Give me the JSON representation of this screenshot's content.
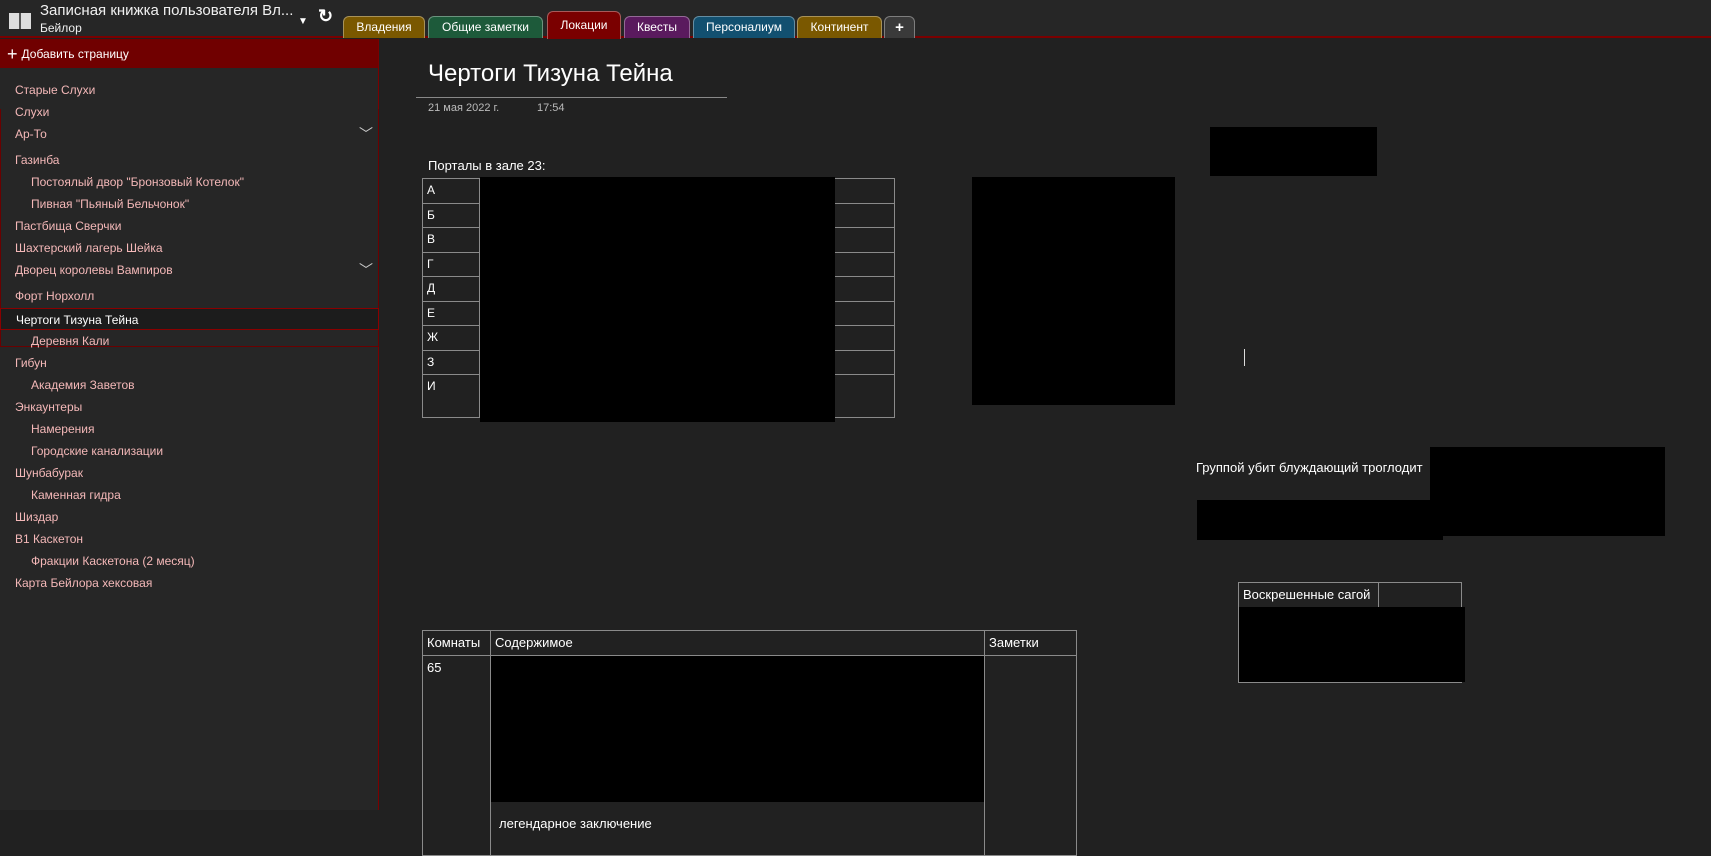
{
  "header": {
    "notebook_title": "Записная книжка пользователя Вл...",
    "notebook_subtitle": "Бейлор"
  },
  "tabs": [
    {
      "label": "Владения",
      "color": "#7a5800"
    },
    {
      "label": "Общие заметки",
      "color": "#1d5a3a"
    },
    {
      "label": "Локации",
      "color": "#7a0000",
      "active": true
    },
    {
      "label": "Квесты",
      "color": "#5a1a5e"
    },
    {
      "label": "Персоналиум",
      "color": "#125070"
    },
    {
      "label": "Континент",
      "color": "#7a5800"
    },
    {
      "label": "+",
      "color": "#3a3a3a"
    }
  ],
  "sidebar": {
    "add_page": "Добавить страницу",
    "items": [
      {
        "label": "Старые Слухи"
      },
      {
        "label": "Слухи"
      },
      {
        "label": "Ар-То"
      },
      {
        "label": "Газинба"
      },
      {
        "label": "Постоялый двор \"Бронзовый Котелок\""
      },
      {
        "label": "Пивная \"Пьяный Бельчонок\""
      },
      {
        "label": "Пастбища Сверчки"
      },
      {
        "label": "Шахтерский лагерь Шейка"
      },
      {
        "label": "Дворец королевы Вампиров"
      },
      {
        "label": "Форт Норхолл"
      },
      {
        "label": "Чертоги Тизуна Тейна"
      },
      {
        "label": "Деревня Кали"
      },
      {
        "label": "Гибун"
      },
      {
        "label": "Академия Заветов"
      },
      {
        "label": "Энкаунтеры"
      },
      {
        "label": "Намерения"
      },
      {
        "label": "Городские канализации"
      },
      {
        "label": "Шунбабурак"
      },
      {
        "label": "Каменная гидра"
      },
      {
        "label": "Шиздар"
      },
      {
        "label": "В1 Каскетон"
      },
      {
        "label": "Фракции Каскетона (2 месяц)"
      },
      {
        "label": "Карта Бейлора хексовая"
      }
    ]
  },
  "page": {
    "title": "Чертоги Тизуна Тейна",
    "date": "21 мая 2022 г.",
    "time": "17:54",
    "portals_label": "Портaлы в зале 23:",
    "portals_rows": [
      "А",
      "Б",
      "В",
      "Г",
      "Д",
      "Е",
      "Ж",
      "З",
      "И"
    ],
    "troglodyte_text": "Группой убит блуждающий троглодит",
    "revived_header": "Воскрешенные сагой",
    "rooms_headers": [
      "Комнаты",
      "Содержимое",
      "Заметки"
    ],
    "rooms_first": "65",
    "cut_text": "легендарное заключение"
  }
}
